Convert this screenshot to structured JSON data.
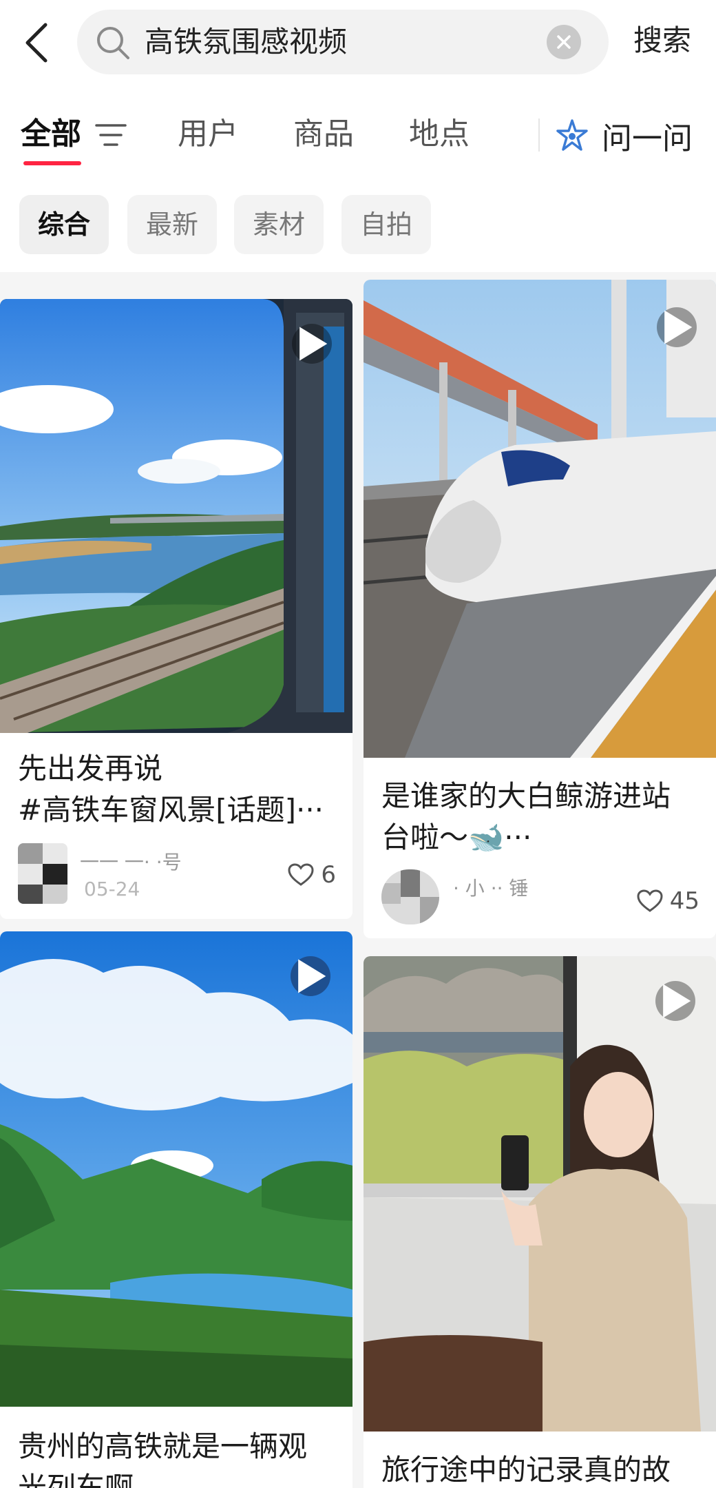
{
  "search": {
    "query": "高铁氛围感视频",
    "submit_label": "搜索"
  },
  "tabs": [
    {
      "label": "全部",
      "active": true
    },
    {
      "label": "用户",
      "active": false
    },
    {
      "label": "商品",
      "active": false
    },
    {
      "label": "地点",
      "active": false
    }
  ],
  "ask_label": "问一问",
  "chips": [
    {
      "label": "综合",
      "active": true
    },
    {
      "label": "最新",
      "active": false
    },
    {
      "label": "素材",
      "active": false
    },
    {
      "label": "自拍",
      "active": false
    }
  ],
  "cards": [
    {
      "title_line1": "先出发再说",
      "title_line2": "#高铁车窗风景[话题]···",
      "author": "一一 一· ·号",
      "date": "05-24",
      "likes": "6",
      "type": "video"
    },
    {
      "title_line1": "是谁家的大白鲸游进站",
      "title_line2": "台啦～🐋···",
      "author": "· 小 ·· 锤",
      "likes": "45",
      "type": "video"
    },
    {
      "title_line1": "贵州的高铁就是一辆观",
      "title_line2": "光列车啊",
      "type": "video"
    },
    {
      "title_line1": "旅行途中的记录真的故",
      "type": "video"
    }
  ],
  "colors": {
    "accent": "#ff2442",
    "background": "#f5f5f5",
    "ask_icon": "#3a7bd5"
  },
  "icons": {
    "back": "chevron-left-icon",
    "search": "search-icon",
    "clear": "clear-icon",
    "filter": "filter-icon",
    "ask": "sparkle-icon",
    "play": "play-icon",
    "like": "heart-icon"
  }
}
